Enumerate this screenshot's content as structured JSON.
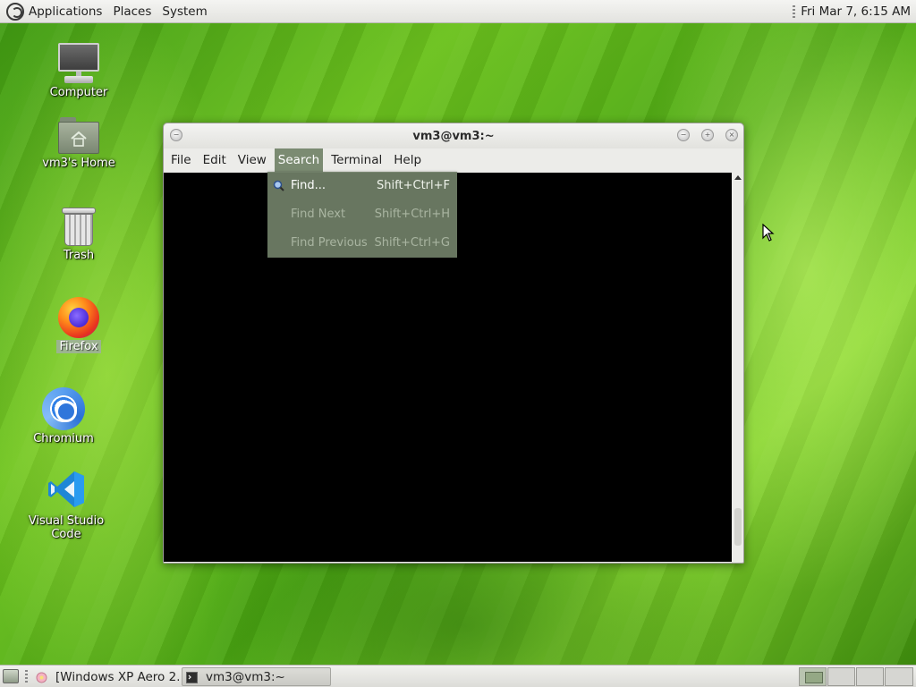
{
  "top_panel": {
    "menus": [
      "Applications",
      "Places",
      "System"
    ],
    "clock": "Fri Mar  7,  6:15 AM"
  },
  "desktop_icons": {
    "computer": "Computer",
    "home": "vm3's Home",
    "trash": "Trash",
    "firefox": "Firefox",
    "chromium": "Chromium",
    "vscode": "Visual Studio Code"
  },
  "window": {
    "title": "vm3@vm3:~",
    "menus": [
      "File",
      "Edit",
      "View",
      "Search",
      "Terminal",
      "Help"
    ],
    "active_menu": "Search"
  },
  "search_menu": {
    "items": [
      {
        "label": "Find...",
        "accel": "Shift+Ctrl+F",
        "enabled": true,
        "icon": "find-icon"
      },
      {
        "label": "Find Next",
        "accel": "Shift+Ctrl+H",
        "enabled": false
      },
      {
        "label": "Find Previous",
        "accel": "Shift+Ctrl+G",
        "enabled": false
      }
    ]
  },
  "taskbar": {
    "tasks": [
      {
        "label": "[Windows XP Aero 2...",
        "icon": "flower-icon",
        "active": false
      },
      {
        "label": "vm3@vm3:~",
        "icon": "terminal-icon",
        "active": true
      }
    ],
    "workspaces": 4,
    "current_workspace": 1
  }
}
